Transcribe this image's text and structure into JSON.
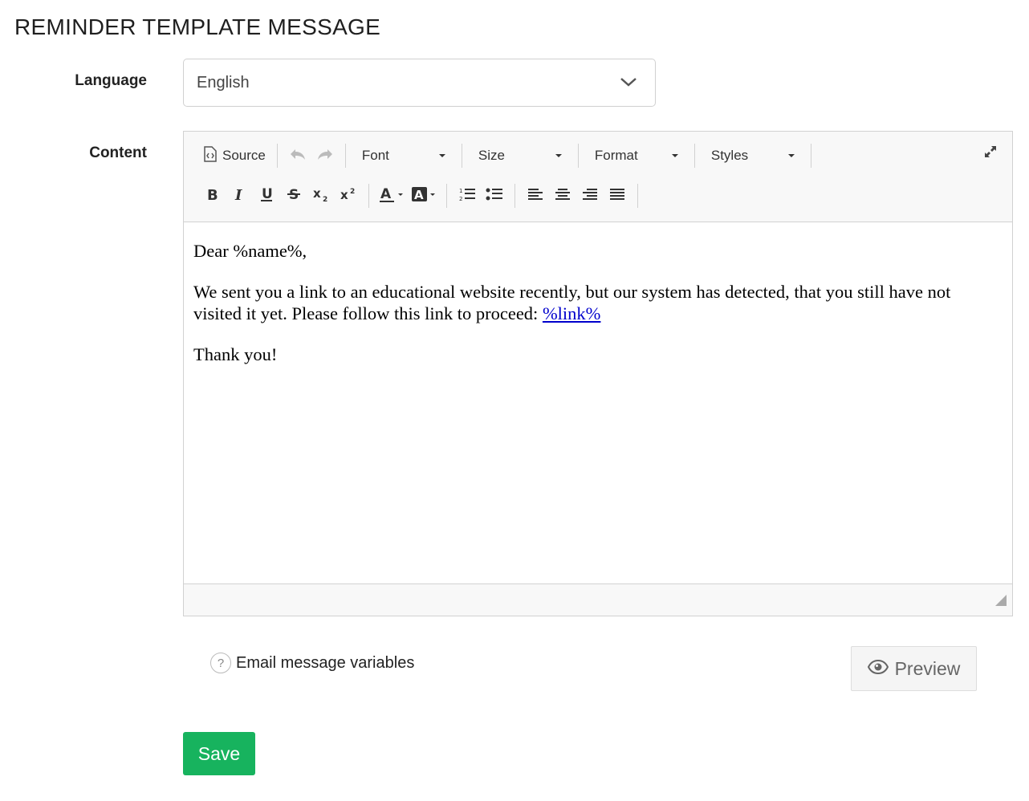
{
  "page": {
    "title": "REMINDER TEMPLATE MESSAGE"
  },
  "language": {
    "label": "Language",
    "selected": "English"
  },
  "content": {
    "label": "Content",
    "toolbar": {
      "source_label": "Source",
      "font_label": "Font",
      "size_label": "Size",
      "format_label": "Format",
      "styles_label": "Styles"
    },
    "body": {
      "greeting": "Dear %name%,",
      "paragraph_text": "We sent you a link to an educational website recently, but our system has detected, that you still have not visited it yet. Please follow this link to proceed: ",
      "link_text": "%link%",
      "closing": "Thank you!"
    }
  },
  "variables_link": {
    "label": "Email message variables"
  },
  "preview_button": {
    "label": "Preview"
  },
  "save_button": {
    "label": "Save"
  },
  "colors": {
    "save_green": "#17b35e",
    "link_blue": "#0000cc"
  }
}
